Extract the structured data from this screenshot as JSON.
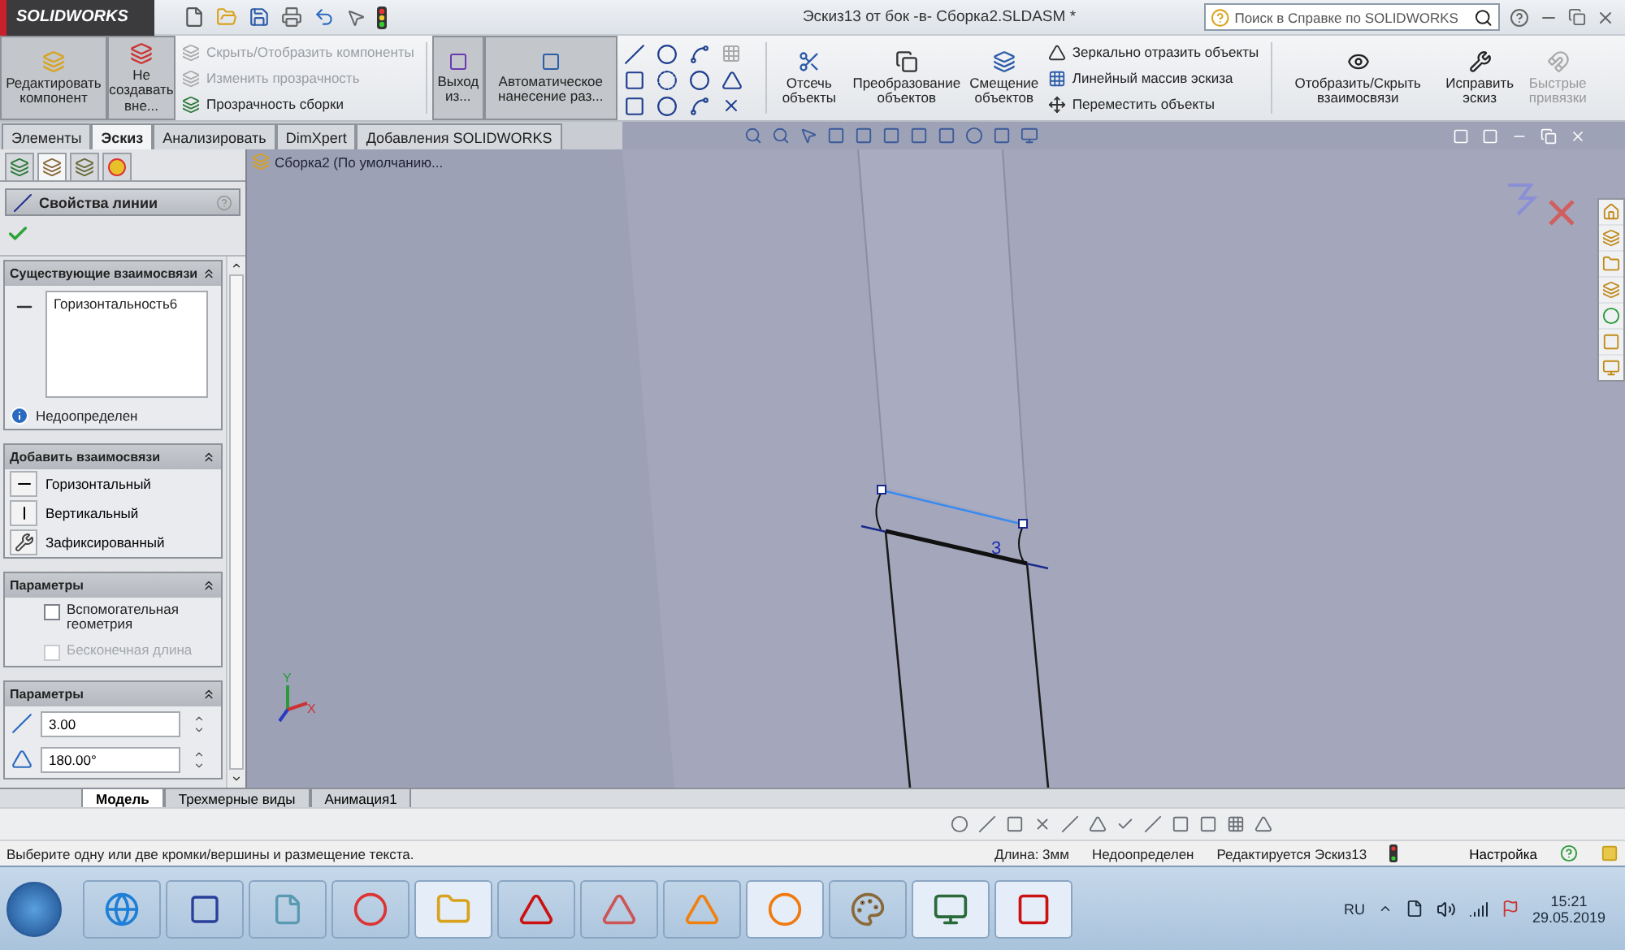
{
  "app": {
    "logo": "SOLIDWORKS",
    "title": "Эскиз13 от бок -в- Сборка2.SLDASM *",
    "search": {
      "placeholder": "Поиск в Справке по SOLIDWORKS"
    }
  },
  "ribbon": {
    "large_buttons": [
      {
        "label": "Редактировать компонент",
        "selected": true
      },
      {
        "label": "Не создавать вне...",
        "selected": true
      }
    ],
    "assembly_items": [
      {
        "label": "Скрыть/Отобразить компоненты",
        "disabled": true
      },
      {
        "label": "Изменить прозрачность",
        "disabled": true
      },
      {
        "label": "Прозрачность сборки",
        "disabled": false
      }
    ],
    "toggle_buttons": [
      {
        "label": "Выход из...",
        "selected": true
      },
      {
        "label": "Автоматическое нанесение раз...",
        "selected": true
      }
    ],
    "tools": [
      {
        "label": "Отсечь объекты",
        "disabled": false
      },
      {
        "label": "Преобразование объектов",
        "disabled": false
      },
      {
        "label": "Смещение объектов",
        "disabled": false
      }
    ],
    "sketch_items": [
      {
        "label": "Зеркально отразить объекты"
      },
      {
        "label": "Линейный массив эскиза"
      },
      {
        "label": "Переместить объекты"
      }
    ],
    "relation_tools": [
      {
        "label": "Отобразить/Скрыть взаимосвязи",
        "disabled": false
      },
      {
        "label": "Исправить эскиз",
        "disabled": false
      },
      {
        "label": "Быстрые привязки",
        "disabled": true
      }
    ]
  },
  "tabs": [
    {
      "label": "Элементы",
      "selected": false
    },
    {
      "label": "Эскиз",
      "selected": true
    },
    {
      "label": "Анализировать",
      "selected": false
    },
    {
      "label": "DimXpert",
      "selected": false
    },
    {
      "label": "Добавления SOLIDWORKS",
      "selected": false
    }
  ],
  "panel_tabs": [
    {
      "selected": false
    },
    {
      "selected": true
    },
    {
      "selected": false
    },
    {
      "selected": false
    }
  ],
  "property_manager": {
    "title": "Свойства линии",
    "existing_relations": {
      "title": "Существующие взаимосвязи",
      "items": [
        "Горизонтальность6"
      ],
      "status": "Недоопределен"
    },
    "add_relations": {
      "title": "Добавить взаимосвязи",
      "items": [
        "Горизонтальный",
        "Вертикальный",
        "Зафиксированный"
      ]
    },
    "options": {
      "title": "Параметры",
      "checkboxes": [
        {
          "label": "Вспомогательная геометрия",
          "checked": false,
          "disabled": false
        },
        {
          "label": "Бесконечная длина",
          "checked": false,
          "disabled": true
        }
      ]
    },
    "parameters": {
      "title": "Параметры",
      "fields": [
        {
          "value": "3.00"
        },
        {
          "value": "180.00°"
        }
      ]
    }
  },
  "viewport": {
    "tree_root": "Сборка2 (По умолчанию...",
    "dimension": "3",
    "axes": [
      "Y",
      "X"
    ]
  },
  "bottom_tabs": [
    {
      "label": "Модель",
      "selected": true
    },
    {
      "label": "Трехмерные виды",
      "selected": false
    },
    {
      "label": "Анимация1",
      "selected": false
    }
  ],
  "status_bar": {
    "message": "Выберите одну или две кромки/вершины и размещение текста.",
    "length": "Длина: 3мм",
    "state": "Недоопределен",
    "editing": "Редактируется Эскиз13",
    "settings": "Настройка"
  },
  "taskbar": {
    "language": "RU",
    "time": "15:21",
    "date": "29.05.2019"
  }
}
